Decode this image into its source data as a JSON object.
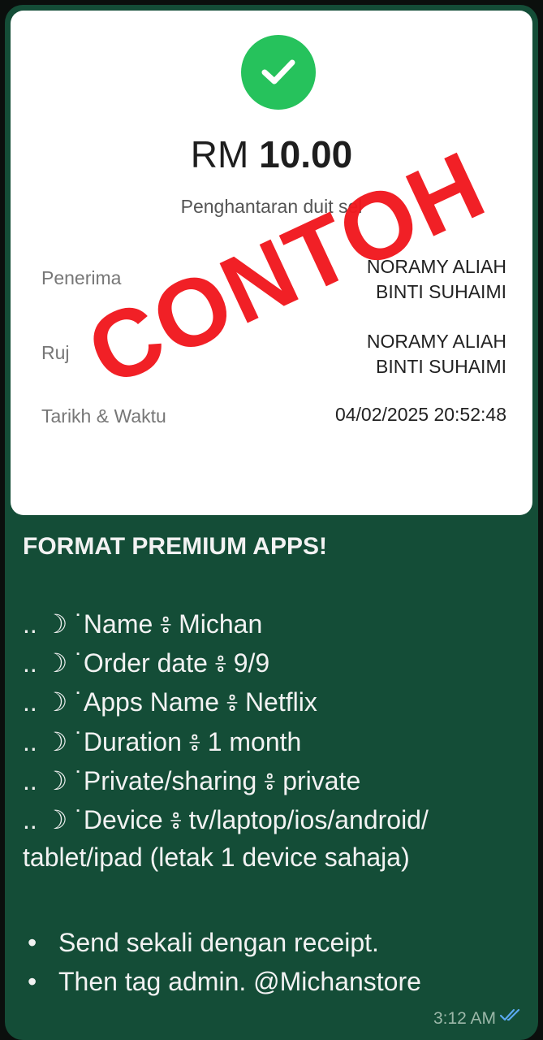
{
  "receipt": {
    "amount_currency": "RM",
    "amount_value": "10.00",
    "subtitle": "Penghantaran duit sel",
    "rows": [
      {
        "label": "Penerima",
        "value_line1": "NORAMY ALIAH",
        "value_line2": "BINTI SUHAIMI"
      },
      {
        "label": "Ruj",
        "value_line1": "NORAMY ALIAH",
        "value_line2": "BINTI SUHAIMI"
      },
      {
        "label": "Tarikh & Waktu",
        "value_line1": "04/02/2025 20:52:48"
      }
    ],
    "stamp": "CONTOH",
    "status_icon": "checkmark-icon",
    "status_color": "#26c25c"
  },
  "message": {
    "title": "FORMAT PREMIUM APPS!",
    "lines": [
      ".. ☽ ˙Name ៖ Michan",
      ".. ☽ ˙Order date ៖ 9/9",
      ".. ☽ ˙Apps Name ៖ Netflix",
      ".. ☽ ˙Duration ៖ 1 month",
      ".. ☽ ˙Private/sharing ៖ private",
      ".. ☽ ˙Device ៖ tv/laptop/ios/android/",
      "tablet/ipad (letak 1 device sahaja)"
    ],
    "bullets": [
      "Send sekali dengan receipt.",
      "Then tag admin. @Michanstore"
    ],
    "bullet_char": "•",
    "time": "3:12 AM",
    "read_icon": "double-check-icon"
  }
}
